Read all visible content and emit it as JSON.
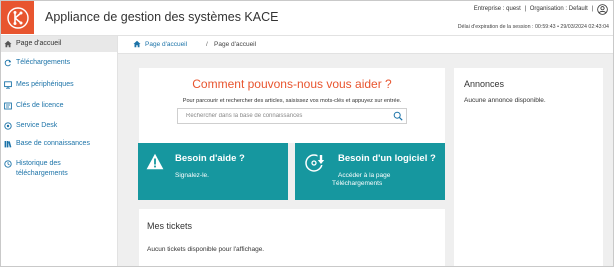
{
  "header": {
    "app_title": "Appliance de gestion des systèmes KACE",
    "entreprise": "Entreprise : quest",
    "separator1": "|",
    "organisation": "Organisation : Default",
    "separator2": "|",
    "session": "Délai d'expiration de la session : 00:59:43 • 29/03/2024 02:43:04"
  },
  "sidebar": {
    "items": [
      {
        "label": "Page d'accueil",
        "icon": "home-icon",
        "active": true
      },
      {
        "label": "Téléchargements",
        "icon": "refresh-icon",
        "active": false
      },
      {
        "label": "Mes périphériques",
        "icon": "monitor-icon",
        "active": false
      },
      {
        "label": "Clés de licence",
        "icon": "license-icon",
        "active": false
      },
      {
        "label": "Service Desk",
        "icon": "service-desk-icon",
        "active": false
      },
      {
        "label": "Base de connaissances",
        "icon": "books-icon",
        "active": false
      },
      {
        "label": "Historique des téléchargements",
        "icon": "history-icon",
        "active": false
      }
    ]
  },
  "breadcrumb": {
    "link": "Page d'accueil",
    "separator": "/",
    "current": "Page d'accueil"
  },
  "search": {
    "title": "Comment pouvons-nous vous aider ?",
    "subtitle": "Pour parcourir et rechercher des articles, saisissez vos mots-clés et appuyez sur entrée.",
    "placeholder": "Rechercher dans la base de connaissances",
    "value": ""
  },
  "tiles": {
    "help": {
      "title": "Besoin d'aide ?",
      "text": "Signalez-le."
    },
    "software": {
      "title": "Besoin d'un logiciel ?",
      "text_line1": "Accéder à la page",
      "text_line2": "Téléchargements"
    }
  },
  "tickets": {
    "title": "Mes tickets",
    "empty": "Aucun tickets disponible pour l'affichage."
  },
  "announcements": {
    "title": "Annonces",
    "empty": "Aucune annonce disponible."
  },
  "colors": {
    "brand_orange": "#e8552f",
    "tile_teal": "#16979f",
    "link_blue": "#1c73a8"
  }
}
